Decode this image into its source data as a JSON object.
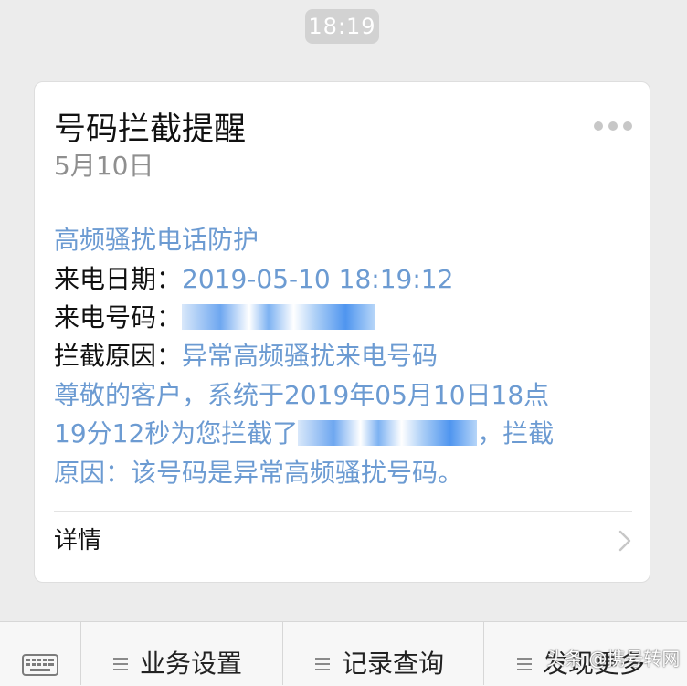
{
  "timestamp": "18:19",
  "card": {
    "title": "号码拦截提醒",
    "date": "5月10日",
    "more_icon": "more-icon",
    "subtitle": "高频骚扰电话防护",
    "call_date_label": "来电日期：",
    "call_date_value": "2019-05-10 18:19:12",
    "call_number_label": "来电号码：",
    "reason_label": "拦截原因：",
    "reason_value": "异常高频骚扰来电号码",
    "message_line1": "尊敬的客户，系统于2019年05月10日18点",
    "message_line2_prefix": "19分12秒为您拦截了",
    "message_line2_suffix": "，拦截",
    "message_line3": "原因：该号码是异常高频骚扰号码。",
    "details_label": "详情",
    "chevron_icon": "chevron-right-icon"
  },
  "bottom_menu": {
    "keyboard_icon": "keyboard-icon",
    "item1": "业务设置",
    "item2": "记录查询",
    "item3": "发现更多"
  },
  "watermark": "头条 @携号转网",
  "colors": {
    "background": "#ececec",
    "card_bg": "#ffffff",
    "blue_text": "#6c9bd2",
    "dark_text": "#111111",
    "timestamp_bg": "#d2d2d2"
  }
}
